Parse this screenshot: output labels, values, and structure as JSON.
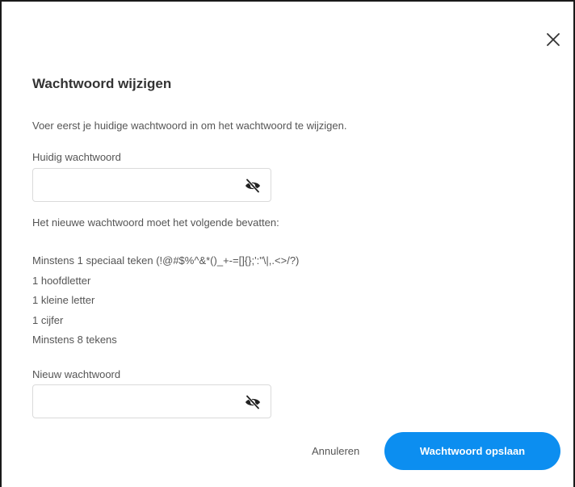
{
  "dialog": {
    "title": "Wachtwoord wijzigen",
    "intro": "Voer eerst je huidige wachtwoord in om het wachtwoord te wijzigen.",
    "close_icon": "close-icon"
  },
  "current_password": {
    "label": "Huidig wachtwoord",
    "value": "",
    "placeholder": "",
    "toggle_icon": "eye-slash-icon"
  },
  "requirements": {
    "heading": "Het nieuwe wachtwoord moet het volgende bevatten:",
    "items": [
      "Minstens 1 speciaal teken (!@#$%^&*()_+-=[]{};':\"\\|,.<>/?)",
      "1 hoofdletter",
      "1 kleine letter",
      "1 cijfer",
      "Minstens 8 tekens"
    ]
  },
  "new_password": {
    "label": "Nieuw wachtwoord",
    "value": "",
    "placeholder": "",
    "toggle_icon": "eye-slash-icon"
  },
  "actions": {
    "cancel_label": "Annuleren",
    "save_label": "Wachtwoord opslaan"
  },
  "colors": {
    "primary": "#0c8ef0",
    "text": "#555555",
    "border": "#dadada"
  }
}
